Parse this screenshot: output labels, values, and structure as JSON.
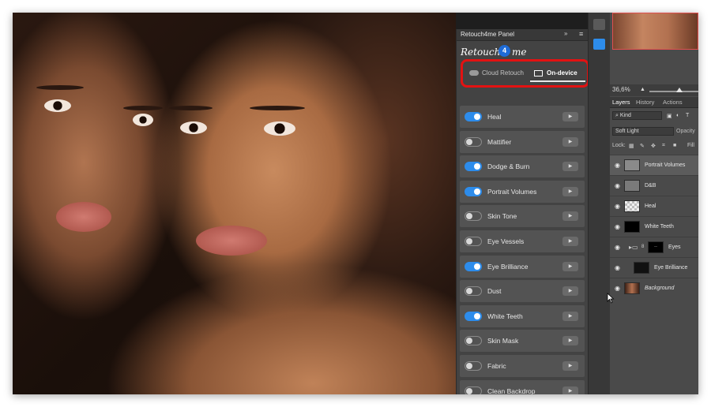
{
  "panel": {
    "title": "Retouch4me Panel",
    "collapse_icon": "»",
    "menu_icon": "≡",
    "brand_left": "Retouch",
    "brand_badge": "4",
    "brand_right": "me",
    "modes": {
      "cloud_label": "Cloud Retouch",
      "device_label": "On-device",
      "selected": "On-device"
    },
    "plugins": [
      {
        "label": "Heal",
        "enabled": true
      },
      {
        "label": "Mattifier",
        "enabled": false
      },
      {
        "label": "Dodge & Burn",
        "enabled": true
      },
      {
        "label": "Portrait Volumes",
        "enabled": true
      },
      {
        "label": "Skin Tone",
        "enabled": false
      },
      {
        "label": "Eye Vessels",
        "enabled": false
      },
      {
        "label": "Eye Brilliance",
        "enabled": true
      },
      {
        "label": "Dust",
        "enabled": false
      },
      {
        "label": "White Teeth",
        "enabled": true
      },
      {
        "label": "Skin Mask",
        "enabled": false
      },
      {
        "label": "Fabric",
        "enabled": false
      },
      {
        "label": "Clean Backdrop",
        "enabled": false
      }
    ],
    "play_glyph": "▶"
  },
  "navigator": {
    "zoom": "36,6%",
    "zoom_glyph": "▲"
  },
  "layers_panel": {
    "tabs": {
      "layers": "Layers",
      "history": "History",
      "actions": "Actions"
    },
    "filter_label": "Kind",
    "blend_mode": "Soft Light",
    "opacity_label": "Opacity",
    "lock_label": "Lock:",
    "fill_label": "Fill",
    "layers": [
      {
        "name": "Portrait Volumes",
        "selected": true
      },
      {
        "name": "D&B",
        "selected": false
      },
      {
        "name": "Heal",
        "selected": false
      },
      {
        "name": "White Teeth",
        "selected": false
      },
      {
        "name": "Eyes",
        "selected": false
      },
      {
        "name": "Eye Brilliance",
        "selected": false
      },
      {
        "name": "Background",
        "selected": false
      }
    ]
  },
  "colors": {
    "accent": "#2d8ceb",
    "highlight_border": "#e31212",
    "panel_bg": "#434343",
    "row_bg": "#535353"
  }
}
